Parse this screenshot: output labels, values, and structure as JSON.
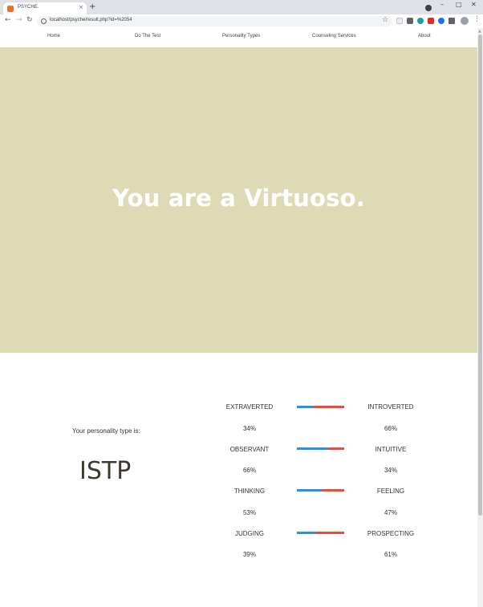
{
  "browser": {
    "tab_title": "PSYCHE.",
    "tab_close": "×",
    "new_tab": "+",
    "url": "localhost/psyche/result.php?id=%2054",
    "window_controls": [
      "–",
      "□",
      "✕"
    ]
  },
  "nav": {
    "items": [
      "Home",
      "Do The Test",
      "Personality Types",
      "Counseling Services",
      "About"
    ]
  },
  "hero": {
    "title": "You are a Virtuoso."
  },
  "result": {
    "label": "Your personality type is:",
    "type_code": "ISTP"
  },
  "traits": [
    {
      "left": "EXTRAVERTED",
      "right": "INTROVERTED",
      "left_pct": "34%",
      "right_pct": "66%",
      "left_value": 34
    },
    {
      "left": "OBSERVANT",
      "right": "INTUITIVE",
      "left_pct": "66%",
      "right_pct": "34%",
      "left_value": 66
    },
    {
      "left": "THINKING",
      "right": "FEELING",
      "left_pct": "53%",
      "right_pct": "47%",
      "left_value": 53
    },
    {
      "left": "JUDGING",
      "right": "PROSPECTING",
      "left_pct": "39%",
      "right_pct": "61%",
      "left_value": 39
    }
  ],
  "colors": {
    "hero_bg": "#dfdab6",
    "bar_left": "#2e8fe0",
    "bar_right": "#e74c3c",
    "type_code": "#3d3a2c"
  }
}
